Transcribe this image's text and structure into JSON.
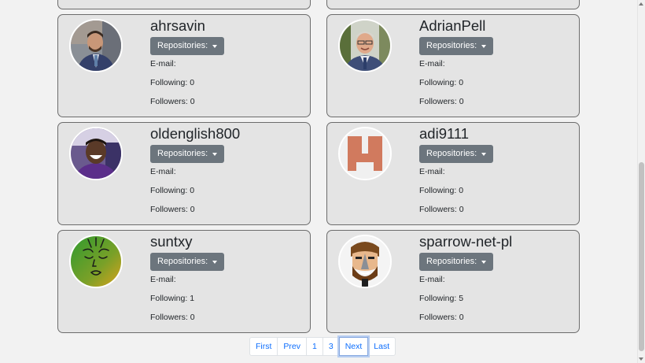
{
  "users": [
    {
      "username": "ahrsavin",
      "repo_label": "Repositories:",
      "email_label": "E-mail:",
      "email": "",
      "following_label": "Following:",
      "following": "0",
      "followers_label": "Followers:",
      "followers": "0",
      "avatar": "photo-man-suit"
    },
    {
      "username": "AdrianPell",
      "repo_label": "Repositories:",
      "email_label": "E-mail:",
      "email": "",
      "following_label": "Following:",
      "following": "0",
      "followers_label": "Followers:",
      "followers": "0",
      "avatar": "photo-man-glasses"
    },
    {
      "username": "oldenglish800",
      "repo_label": "Repositories:",
      "email_label": "E-mail:",
      "email": "",
      "following_label": "Following:",
      "following": "0",
      "followers_label": "Followers:",
      "followers": "0",
      "avatar": "photo-man-smiling"
    },
    {
      "username": "adi9111",
      "repo_label": "Repositories:",
      "email_label": "E-mail:",
      "email": "",
      "following_label": "Following:",
      "following": "0",
      "followers_label": "Followers:",
      "followers": "0",
      "avatar": "identicon-orange"
    },
    {
      "username": "suntxy",
      "repo_label": "Repositories:",
      "email_label": "E-mail:",
      "email": "",
      "following_label": "Following:",
      "following": "1",
      "followers_label": "Followers:",
      "followers": "0",
      "avatar": "drawn-green-face"
    },
    {
      "username": "sparrow-net-pl",
      "repo_label": "Repositories:",
      "email_label": "E-mail:",
      "email": "",
      "following_label": "Following:",
      "following": "5",
      "followers_label": "Followers:",
      "followers": "0",
      "avatar": "cartoon-bearded-man"
    }
  ],
  "pagination": {
    "first": "First",
    "prev": "Prev",
    "page1": "1",
    "page3": "3",
    "next": "Next",
    "last": "Last",
    "focused": "Next"
  },
  "colors": {
    "card_bg": "#e4e4e4",
    "card_border": "#6c6c6c",
    "button_bg": "#6c757d",
    "link": "#0d6efd",
    "page_bg": "#f2f2f2"
  }
}
